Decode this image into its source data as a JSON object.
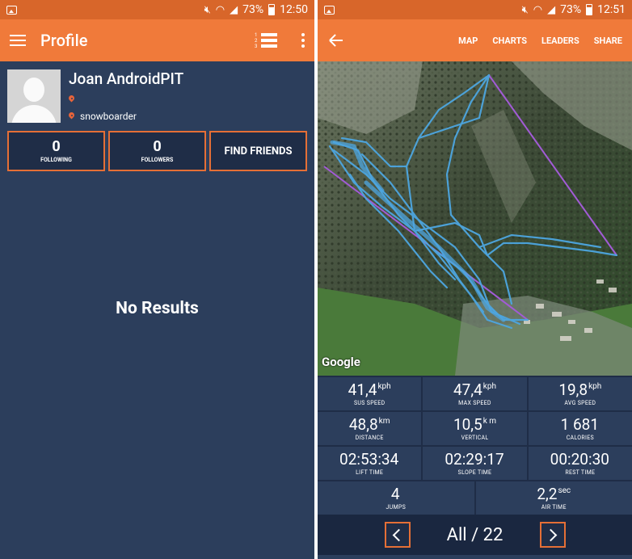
{
  "left": {
    "status": {
      "battery": "73%",
      "time": "12:50"
    },
    "appbar": {
      "title": "Profile"
    },
    "profile": {
      "name": "Joan AndroidPIT",
      "location": "",
      "role": "snowboarder"
    },
    "stats": {
      "following_count": "0",
      "following_label": "FOLLOWING",
      "followers_count": "0",
      "followers_label": "FOLLOWERS",
      "find_friends": "FIND FRIENDS"
    },
    "empty_message": "No Results"
  },
  "right": {
    "status": {
      "battery": "73%",
      "time": "12:51"
    },
    "appbar": {
      "links": [
        "MAP",
        "CHARTS",
        "LEADERS",
        "SHARE"
      ]
    },
    "map": {
      "attribution": "Google"
    },
    "metrics": [
      [
        {
          "value": "41,4",
          "unit": "kph",
          "label": "SUS SPEED"
        },
        {
          "value": "47,4",
          "unit": "kph",
          "label": "MAX SPEED"
        },
        {
          "value": "19,8",
          "unit": "kph",
          "label": "AVG SPEED"
        }
      ],
      [
        {
          "value": "48,8",
          "unit": "km",
          "label": "DISTANCE"
        },
        {
          "value": "10,5",
          "unit": "k m",
          "label": "VERTICAL"
        },
        {
          "value": "1 681",
          "unit": "",
          "label": "CALORIES"
        }
      ],
      [
        {
          "value": "02:53:34",
          "unit": "",
          "label": "LIFT TIME"
        },
        {
          "value": "02:29:17",
          "unit": "",
          "label": "SLOPE TIME"
        },
        {
          "value": "00:20:30",
          "unit": "",
          "label": "REST TIME"
        }
      ],
      [
        {
          "value": "4",
          "unit": "",
          "label": "JUMPS"
        },
        {
          "value": "2,2",
          "unit": "sec",
          "label": "AIR TIME"
        }
      ]
    ],
    "pager": {
      "text": "All / 22"
    }
  },
  "colors": {
    "status_bar": "#d8662a",
    "app_bar": "#f07a3a",
    "background": "#2c3e5c",
    "box_background": "#1f2d47",
    "accent_border": "#e56f36",
    "track": "#4da6e0",
    "lift_line": "#a25bd6"
  }
}
